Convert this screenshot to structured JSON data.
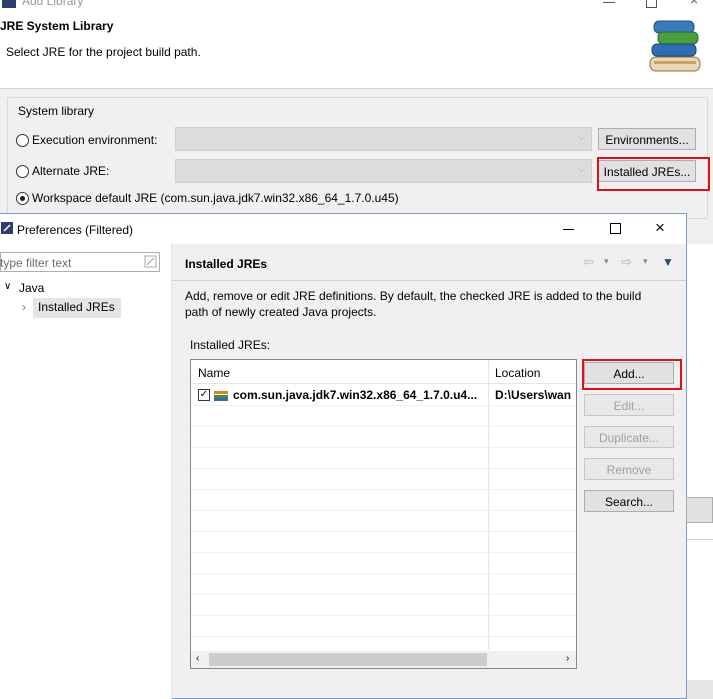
{
  "add_library": {
    "window_title": "Add Library",
    "header_title": "JRE System Library",
    "header_desc": "Select JRE for the project build path.",
    "group_label": "System library",
    "exec_env_label": "Execution environment:",
    "alt_jre_label": "Alternate JRE:",
    "workspace_label": "Workspace default JRE (com.sun.java.jdk7.win32.x86_64_1.7.0.u45)",
    "environments_button": "Environments...",
    "installed_jres_button": "Installed JREs..."
  },
  "preferences": {
    "window_title": "Preferences (Filtered)",
    "filter_placeholder": "type filter text",
    "tree": {
      "java": "Java",
      "installed_jres": "Installed JREs"
    },
    "page_title": "Installed JREs",
    "description": "Add, remove or edit JRE definitions. By default, the checked JRE is added to the build path of newly created Java projects.",
    "list_label": "Installed JREs:",
    "columns": {
      "name": "Name",
      "location": "Location"
    },
    "rows": [
      {
        "name": "com.sun.java.jdk7.win32.x86_64_1.7.0.u4...",
        "location": "D:\\Users\\wan",
        "checked": true
      }
    ],
    "buttons": {
      "add": "Add...",
      "edit": "Edit...",
      "duplicate": "Duplicate...",
      "remove": "Remove",
      "search": "Search..."
    }
  },
  "colors": {
    "highlight": "#d8131b",
    "selection": "#e5e5e5"
  }
}
